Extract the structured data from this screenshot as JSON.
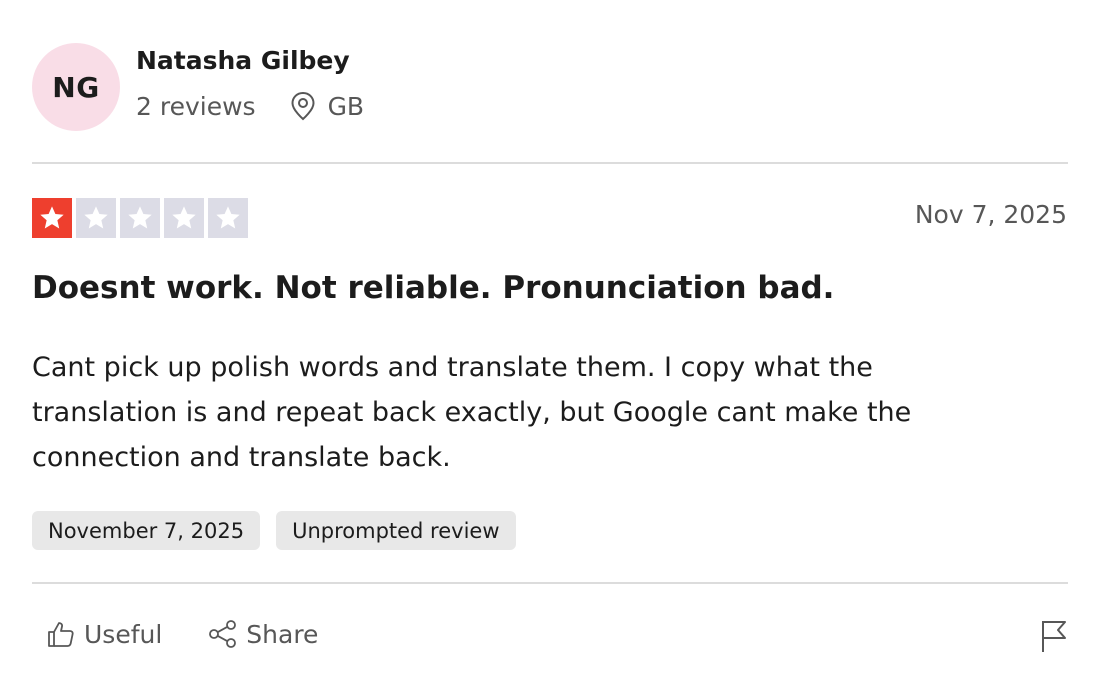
{
  "reviewer": {
    "initials": "NG",
    "name": "Natasha Gilbey",
    "reviews_count": "2 reviews",
    "country": "GB",
    "avatar_color": "#f9dde7"
  },
  "review": {
    "rating": 1,
    "rating_max": 5,
    "date": "Nov 7, 2025",
    "title": "Doesnt work. Not reliable. Pronunciation bad.",
    "body": "Cant pick up polish words and translate them. I copy what the translation is and repeat back exactly, but Google cant make the connection and translate back.",
    "tags": [
      "November 7, 2025",
      "Unprompted review"
    ]
  },
  "actions": {
    "useful_label": "Useful",
    "share_label": "Share"
  },
  "icons": {
    "location": "location-pin-icon",
    "useful": "thumbs-up-icon",
    "share": "share-icon",
    "flag": "flag-icon"
  },
  "colors": {
    "star_filled": "#ee3f2e",
    "star_empty": "#dcdce6",
    "tag_bg": "#e8e8e8",
    "muted_text": "#575757"
  }
}
